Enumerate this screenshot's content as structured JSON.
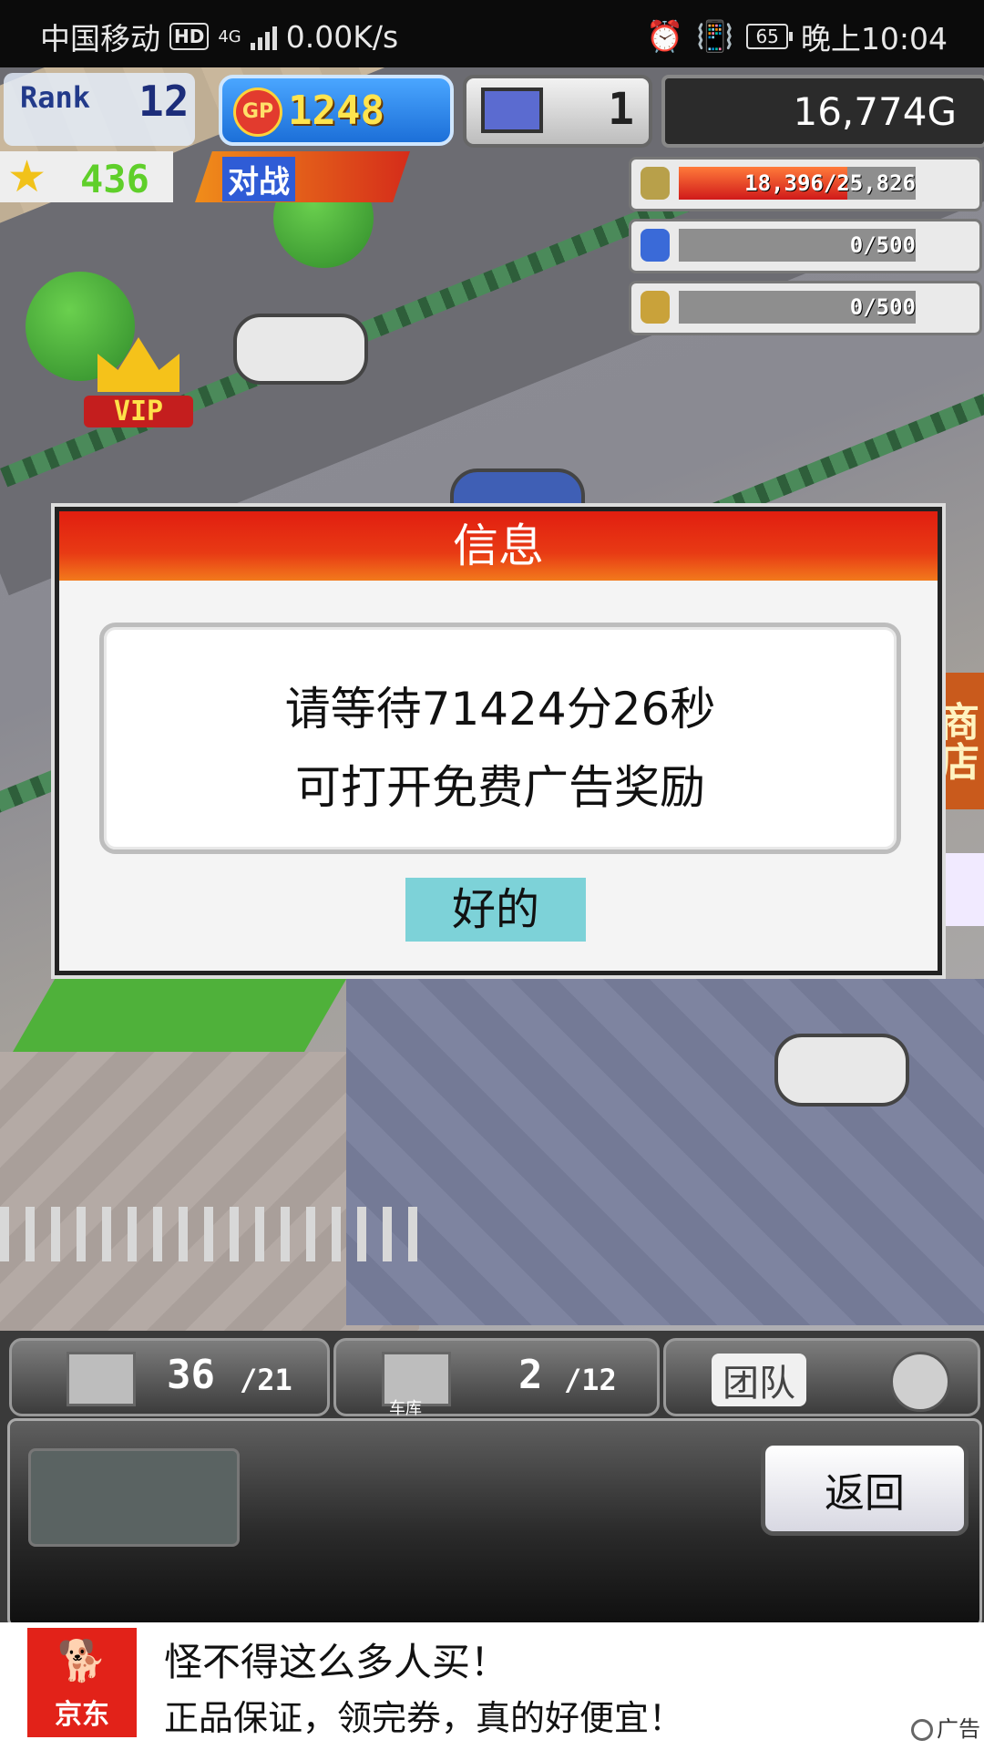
{
  "status_bar": {
    "carrier": "中国移动",
    "hd": "HD",
    "network": "4G",
    "speed": "0.00K/s",
    "battery": "65",
    "time": "晚上10:04"
  },
  "hud": {
    "rank_label": "Rank",
    "rank_value": "12",
    "gp_icon": "GP",
    "gp_value": "1248",
    "computer_value": "1",
    "money": "16,774G",
    "star_value": "436",
    "battle_label": "对战",
    "resources": [
      {
        "icon": "coin-stack-icon",
        "text": "18,396/25,826",
        "fraction": 0.712,
        "color": "#e23a1a"
      },
      {
        "icon": "fuel-bottle-icon",
        "text": "0/500",
        "fraction": 0,
        "color": "#e23a1a"
      },
      {
        "icon": "wheat-icon",
        "text": "0/500",
        "fraction": 0,
        "color": "#e23a1a"
      }
    ]
  },
  "scene": {
    "vip_label": "VIP",
    "shop_sign": "商店"
  },
  "dialog": {
    "title": "信息",
    "message_line1": "请等待71424分26秒",
    "message_line2": "可打开免费广告奖励",
    "ok_label": "好的"
  },
  "bottom_bar": {
    "storage_count": "36",
    "storage_capacity": "/21",
    "garage_count": "2",
    "garage_capacity": "/12",
    "garage_label": "车库",
    "team_label": "团队",
    "back_label": "返回"
  },
  "ad": {
    "brand": "京东",
    "headline": "怪不得这么多人买！",
    "subline": "正品保证，领完券，真的好便宜！",
    "badge": "广告"
  },
  "colors": {
    "dialog_title_red": "#e11e10",
    "ok_button": "#7dd2d8",
    "ad_brand_red": "#e22219"
  }
}
